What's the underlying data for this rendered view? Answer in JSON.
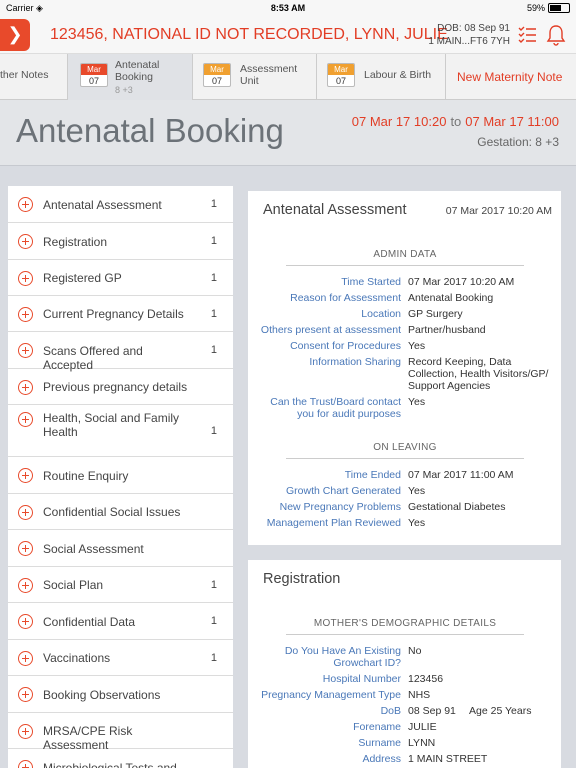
{
  "status_bar": {
    "carrier": "Carrier",
    "time": "8:53 AM",
    "battery": "59%",
    "battery_level": 0.59
  },
  "header": {
    "back_icon": "chevron-right-icon",
    "patient": "123456, NATIONAL ID NOT RECORDED, LYNN, JULIE",
    "dob": "DOB: 08 Sep 91",
    "address": "1 MAIN...FT6 7YH",
    "accent_color": "#e23d25"
  },
  "tabs": [
    {
      "label": "ther Notes"
    },
    {
      "month": "Mar",
      "day": "07",
      "label": "Antenatal Booking",
      "sub": "8 +3",
      "month_color": "#e84a2b"
    },
    {
      "month": "Mar",
      "day": "07",
      "label": "Assessment Unit",
      "month_color": "#f0a030"
    },
    {
      "month": "Mar",
      "day": "07",
      "label": "Labour & Birth",
      "month_color": "#f0a030"
    },
    {
      "label": "New Maternity Note"
    }
  ],
  "title": {
    "text": "Antenatal Booking",
    "start": "07 Mar 17 10:20",
    "to": "to",
    "end": "07 Mar 17 11:00",
    "gestation": "Gestation: 8 +3"
  },
  "sections": [
    {
      "label": "Antenatal Assessment",
      "count": "1"
    },
    {
      "label": "Registration",
      "count": "1"
    },
    {
      "label": "Registered GP",
      "count": "1"
    },
    {
      "label": "Current Pregnancy Details",
      "count": "1"
    },
    {
      "label": "Scans Offered and Accepted",
      "count": "1"
    },
    {
      "label": "Previous pregnancy details",
      "count": ""
    },
    {
      "label": "Health, Social and Family Health",
      "count": "1"
    },
    {
      "label": "Routine Enquiry",
      "count": ""
    },
    {
      "label": "Confidential Social Issues",
      "count": ""
    },
    {
      "label": "Social Assessment",
      "count": ""
    },
    {
      "label": "Social Plan",
      "count": "1"
    },
    {
      "label": "Confidential Data",
      "count": "1"
    },
    {
      "label": "Vaccinations",
      "count": "1"
    },
    {
      "label": "Booking Observations",
      "count": ""
    },
    {
      "label": "MRSA/CPE Risk Assessment",
      "count": ""
    },
    {
      "label": "Microbiological Tests and",
      "count": ""
    }
  ],
  "assessment_card": {
    "title": "Antenatal Assessment",
    "date": "07 Mar 2017 10:20 AM",
    "admin_heading": "ADMIN DATA",
    "admin_fields": [
      {
        "label": "Time Started",
        "value": "07 Mar 2017 10:20 AM"
      },
      {
        "label": "Reason for Assessment",
        "value": "Antenatal Booking"
      },
      {
        "label": "Location",
        "value": "GP Surgery"
      },
      {
        "label": "Others present at assessment",
        "value": "Partner/husband"
      },
      {
        "label": "Consent for Procedures",
        "value": "Yes"
      },
      {
        "label": "Information Sharing",
        "value": "Record Keeping, Data Collection, Health Visitors/GP/ Support Agencies"
      },
      {
        "label": "Can the Trust/Board contact you for audit purposes",
        "value": "Yes"
      }
    ],
    "leaving_heading": "ON LEAVING",
    "leaving_fields": [
      {
        "label": "Time Ended",
        "value": "07 Mar 2017 11:00 AM"
      },
      {
        "label": "Growth Chart Generated",
        "value": "Yes"
      },
      {
        "label": "New Pregnancy Problems",
        "value": "Gestational Diabetes"
      },
      {
        "label": "Management Plan Reviewed",
        "value": "Yes"
      }
    ]
  },
  "registration_card": {
    "title": "Registration",
    "heading": "MOTHER'S DEMOGRAPHIC DETAILS",
    "fields": [
      {
        "label": "Do You Have An Existing Growchart ID?",
        "value": "No"
      },
      {
        "label": "Hospital Number",
        "value": "123456"
      },
      {
        "label": "Pregnancy Management Type",
        "value": "NHS"
      },
      {
        "label": "DoB",
        "value": "08 Sep 91",
        "value2": "Age  25 Years"
      },
      {
        "label": "Forename",
        "value": "JULIE"
      },
      {
        "label": "Surname",
        "value": "LYNN"
      },
      {
        "label": "Address",
        "value": "1 MAIN STREET"
      }
    ]
  }
}
